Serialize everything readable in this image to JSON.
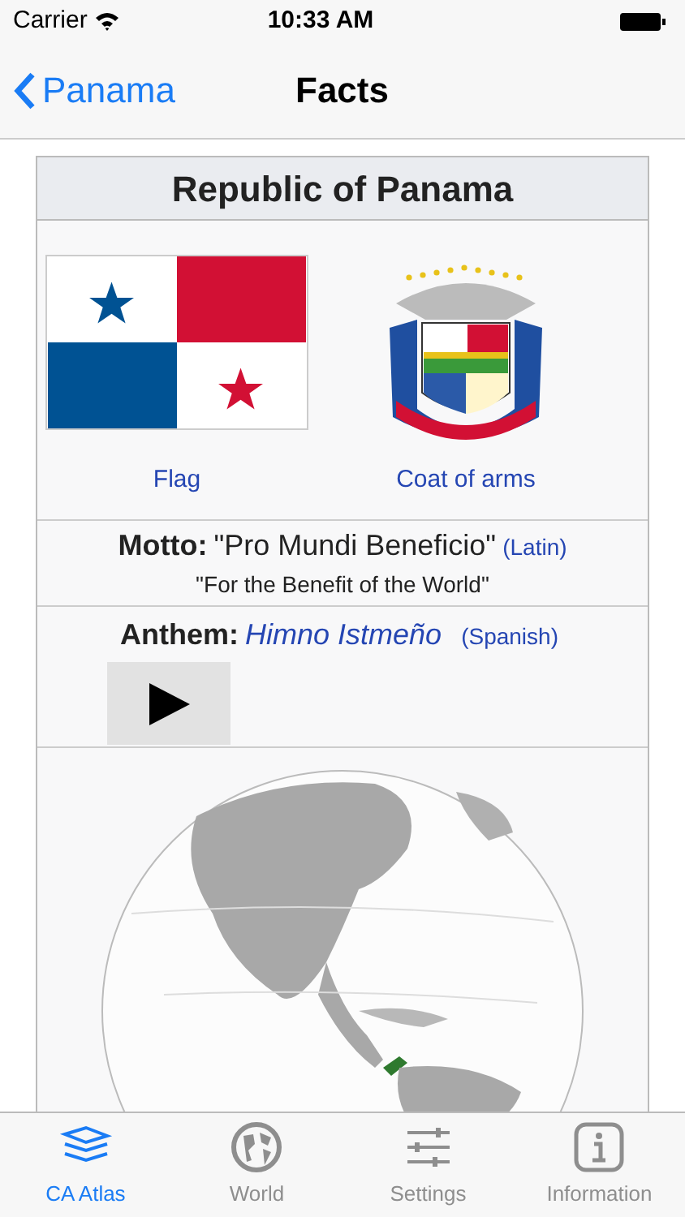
{
  "status_bar": {
    "carrier": "Carrier",
    "time": "10:33 AM"
  },
  "nav": {
    "back": "Panama",
    "title": "Facts"
  },
  "card": {
    "title": "Republic of Panama",
    "images": [
      {
        "kind": "flag",
        "caption": "Flag"
      },
      {
        "kind": "coat",
        "caption": "Coat of arms"
      }
    ],
    "motto": {
      "label": "Motto:",
      "value": "\"Pro Mundi Beneficio\"",
      "language": "(Latin)",
      "translation": "\"For the Benefit of the World\""
    },
    "anthem": {
      "label": "Anthem:",
      "title": "Himno Istmeño",
      "language": "(Spanish)"
    }
  },
  "tabs": [
    {
      "label": "CA Atlas",
      "kind": "layers",
      "selected": true
    },
    {
      "label": "World",
      "kind": "globe",
      "selected": false
    },
    {
      "label": "Settings",
      "kind": "sliders",
      "selected": false
    },
    {
      "label": "Information",
      "kind": "info",
      "selected": false
    }
  ]
}
